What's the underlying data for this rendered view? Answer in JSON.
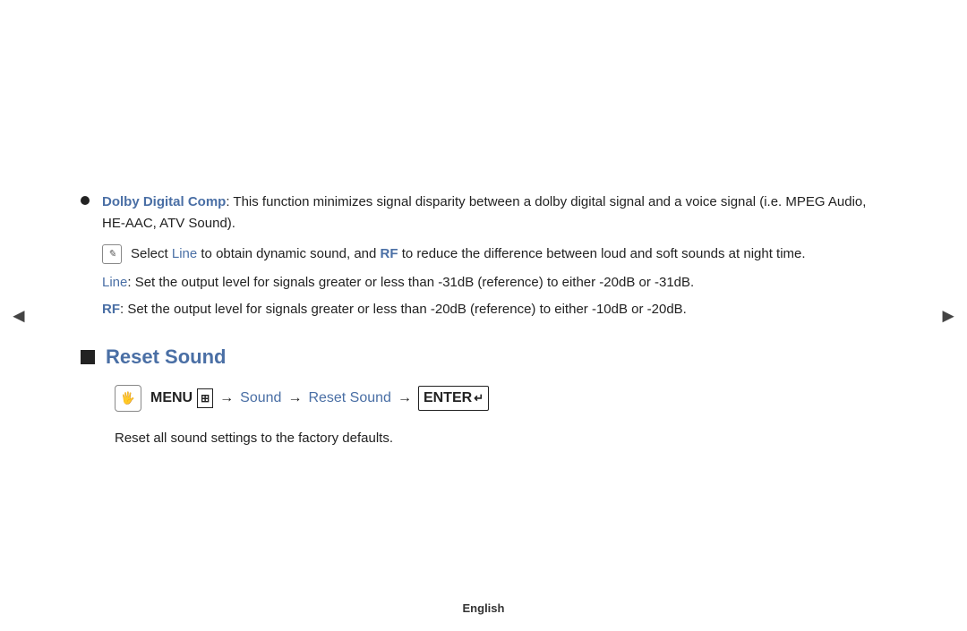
{
  "nav": {
    "left_arrow": "◄",
    "right_arrow": "►"
  },
  "bullet": {
    "term": "Dolby Digital Comp",
    "description": ": This function minimizes signal disparity between a dolby digital signal and a voice signal (i.e. MPEG Audio, HE-AAC, ATV Sound).",
    "note_icon": "✎",
    "note_text_prefix": "Select ",
    "note_line_label": "Line",
    "note_text_middle": " to obtain dynamic sound, and ",
    "note_rf_label": "RF",
    "note_text_end": " to reduce the difference between loud and soft sounds at night time.",
    "line_label": "Line",
    "line_desc": ": Set the output level for signals greater or less than -31dB (reference) to either -20dB or -31dB.",
    "rf_label": "RF",
    "rf_desc": ": Set the output level for signals greater or less than -20dB (reference) to either -10dB or -20dB."
  },
  "section": {
    "title": "Reset Sound",
    "menu_icon_text": "fn",
    "menu_keyword": "MENU",
    "menu_grid": "⊞",
    "arrow1": "→",
    "menu_sound": "Sound",
    "arrow2": "→",
    "menu_reset": "Reset Sound",
    "arrow3": "→",
    "enter_label": "ENTER",
    "enter_icon": "↵",
    "description": "Reset all sound settings to the factory defaults."
  },
  "footer": {
    "language": "English"
  }
}
